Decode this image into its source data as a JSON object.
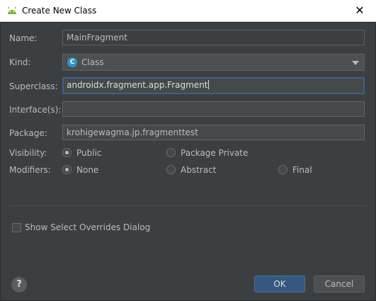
{
  "window": {
    "title": "Create New Class",
    "close_glyph": "✕",
    "icon": "android-icon"
  },
  "form": {
    "name_label": "Name:",
    "name_value": "MainFragment",
    "kind_label": "Kind:",
    "kind_value": "Class",
    "kind_icon_letter": "C",
    "superclass_label": "Superclass:",
    "superclass_value": "androidx.fragment.app.Fragment",
    "interfaces_label": "Interface(s):",
    "interfaces_value": "",
    "package_label": "Package:",
    "package_value": "krohigewagma.jp.fragmenttest",
    "visibility_label": "Visibility:",
    "visibility_options": [
      "Public",
      "Package Private"
    ],
    "visibility_selected": "Public",
    "modifiers_label": "Modifiers:",
    "modifiers_options": [
      "None",
      "Abstract",
      "Final"
    ],
    "modifiers_selected": "None"
  },
  "options": {
    "show_overrides_label": "Show Select Overrides Dialog",
    "show_overrides_checked": false
  },
  "buttons": {
    "help_glyph": "?",
    "ok_label": "OK",
    "cancel_label": "Cancel"
  },
  "colors": {
    "background": "#3c3f41",
    "accent": "#365880",
    "focus": "#3d6185"
  }
}
